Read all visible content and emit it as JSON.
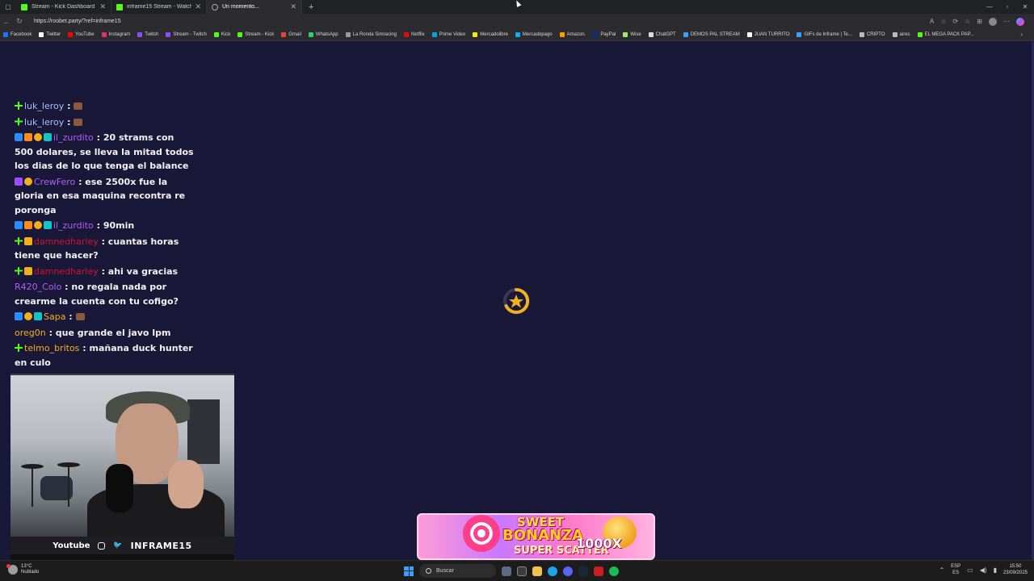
{
  "browser": {
    "tabs": [
      {
        "title": "Stream - Kick Dashboard",
        "icon": "kick-icon",
        "active": false
      },
      {
        "title": "inframe15 Stream - Watch Live o",
        "icon": "kick-icon",
        "active": false
      },
      {
        "title": "Un momento...",
        "icon": "globe-icon",
        "active": true
      }
    ],
    "url": "https://roobet.party/?ref=inframe15",
    "bookmarks": [
      {
        "label": "Facebook",
        "color": "#1877f2"
      },
      {
        "label": "Twitter",
        "color": "#ffffff"
      },
      {
        "label": "YouTube",
        "color": "#ff0000"
      },
      {
        "label": "Instagram",
        "color": "#e1306c"
      },
      {
        "label": "Twitch",
        "color": "#9146ff"
      },
      {
        "label": "Stream - Twitch",
        "color": "#9146ff"
      },
      {
        "label": "Kick",
        "color": "#53fc18"
      },
      {
        "label": "Stream - Kick",
        "color": "#53fc18"
      },
      {
        "label": "Gmail",
        "color": "#ea4335"
      },
      {
        "label": "WhatsApp",
        "color": "#25d366"
      },
      {
        "label": "La Ronda Simracing",
        "color": "#999999"
      },
      {
        "label": "Netflix",
        "color": "#e50914"
      },
      {
        "label": "Prime Video",
        "color": "#00a8e1"
      },
      {
        "label": "Mercadolibre",
        "color": "#ffe600"
      },
      {
        "label": "Mercadopago",
        "color": "#00b1ea"
      },
      {
        "label": "Amazon.",
        "color": "#ff9900"
      },
      {
        "label": "PayPal",
        "color": "#003087"
      },
      {
        "label": "Wise",
        "color": "#9fe870"
      },
      {
        "label": "ChatGPT",
        "color": "#dddddd"
      },
      {
        "label": "DEMOS PAL STREAM",
        "color": "#3aa0ff"
      },
      {
        "label": "JUAN TURRITO",
        "color": "#ffffff"
      },
      {
        "label": "GIFs de Inframe | Te...",
        "color": "#3aa0ff"
      },
      {
        "label": "CRIPTO",
        "color": "#bbbbbb"
      },
      {
        "label": "aires",
        "color": "#bbbbbb"
      },
      {
        "label": "EL MEGA PACK PAP...",
        "color": "#53fc18"
      }
    ]
  },
  "chat": {
    "messages": [
      {
        "user": "luk_leroy",
        "color": "#9fc3ff",
        "badges": [
          "green"
        ],
        "text": "",
        "emote": true
      },
      {
        "user": "luk_leroy",
        "color": "#9fc3ff",
        "badges": [
          "green"
        ],
        "text": "",
        "emote": true
      },
      {
        "user": "il_zurdito",
        "color": "#b25cff",
        "badges": [
          "blue",
          "orange",
          "gold",
          "teal"
        ],
        "text": "20 strams con 500 dolares, se lleva la mitad todos los dias de lo que tenga el balance",
        "emote": false
      },
      {
        "user": "CrewFero",
        "color": "#b25cff",
        "badges": [
          "purple",
          "gold"
        ],
        "text": "ese 2500x fue la gloria en esa maquina recontra re poronga",
        "emote": false
      },
      {
        "user": "il_zurdito",
        "color": "#b25cff",
        "badges": [
          "blue",
          "orange",
          "gold",
          "teal"
        ],
        "text": "90min",
        "emote": false
      },
      {
        "user": "damnedharley",
        "color": "#d2142e",
        "badges": [
          "green",
          "crown"
        ],
        "text": "cuantas horas tiene que hacer?",
        "emote": false
      },
      {
        "user": "damnedharley",
        "color": "#d2142e",
        "badges": [
          "green",
          "crown"
        ],
        "text": "ahi va gracias",
        "emote": false
      },
      {
        "user": "R420_Colo",
        "color": "#b25cff",
        "badges": [],
        "text": "no regala nada por crearme la cuenta con tu cofigo?",
        "emote": false
      },
      {
        "user": "Sapa",
        "color": "#f2b01e",
        "badges": [
          "blue",
          "gold",
          "teal"
        ],
        "text": "",
        "emote": true
      },
      {
        "user": "oreg0n",
        "color": "#f2b01e",
        "badges": [],
        "text": "que grande el javo lpm",
        "emote": false
      },
      {
        "user": "telmo_britos",
        "color": "#f2b01e",
        "badges": [
          "green"
        ],
        "text": "mañana duck hunter en culo",
        "emote": false
      }
    ]
  },
  "webcam": {
    "footer_youtube": "Youtube",
    "footer_brand": "INFRAME15"
  },
  "banner": {
    "line1": "SWEET",
    "line2": "BONANZA",
    "line3": "SUPER SCATTER",
    "multiplier": "1000X"
  },
  "taskbar": {
    "temp": "13°C",
    "weather": "Nublado",
    "search_placeholder": "Buscar",
    "lang_top": "ESP",
    "lang_bottom": "ES",
    "time": "15:50",
    "date": "23/09/2025"
  },
  "colors": {
    "page_background": "#1a1838",
    "kick_green": "#53fc18",
    "spinner_gold": "#f2b01e"
  }
}
